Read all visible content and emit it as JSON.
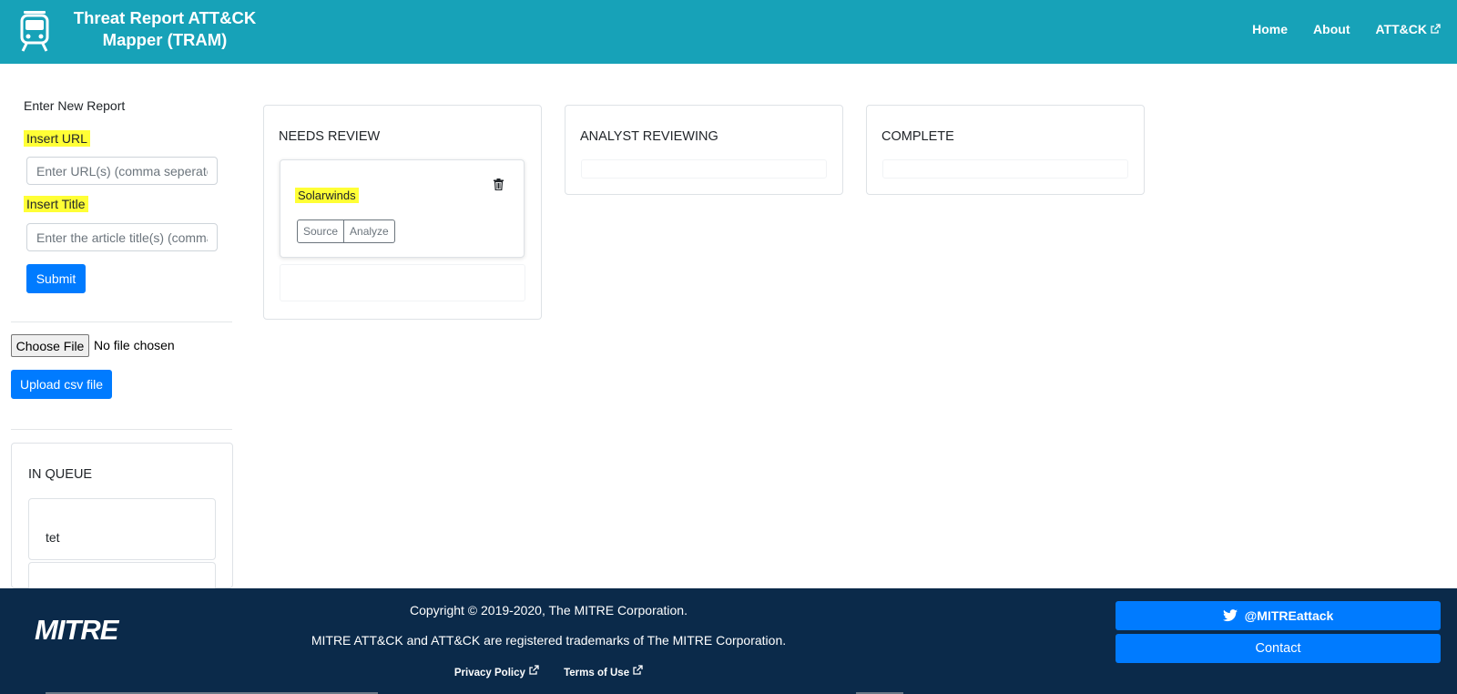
{
  "header": {
    "title": "Threat Report ATT&CK Mapper (TRAM)",
    "nav": {
      "home": "Home",
      "about": "About",
      "attack": "ATT&CK"
    }
  },
  "sidebar": {
    "enter_label": "Enter New Report",
    "url_label": "Insert URL",
    "url_placeholder": "Enter URL(s) (comma seperated)",
    "title_label": "Insert Title",
    "title_placeholder": "Enter the article title(s) (comma seperated)",
    "submit_label": "Submit",
    "choose_file_label": "Choose File",
    "no_file_text": "No file chosen",
    "upload_label": "Upload csv file",
    "queue": {
      "title": "IN QUEUE",
      "items": [
        "tet"
      ]
    }
  },
  "board": {
    "needs_review": {
      "title": "NEEDS REVIEW",
      "cards": [
        {
          "title": "Solarwinds",
          "source_label": "Source",
          "analyze_label": "Analyze"
        }
      ]
    },
    "analyst_reviewing": {
      "title": "ANALYST REVIEWING"
    },
    "complete": {
      "title": "COMPLETE"
    }
  },
  "footer": {
    "logo": "MITRE",
    "copyright": "Copyright © 2019-2020, The MITRE Corporation.",
    "trademark": "MITRE ATT&CK and ATT&CK are registered trademarks of The MITRE Corporation.",
    "privacy": "Privacy Policy",
    "terms": "Terms of Use",
    "twitter": "@MITREattack",
    "contact": "Contact"
  },
  "colors": {
    "header_bg": "#17a2b8",
    "footer_bg": "#0b2a4a",
    "primary": "#007bff",
    "highlight": "#ffff36"
  }
}
